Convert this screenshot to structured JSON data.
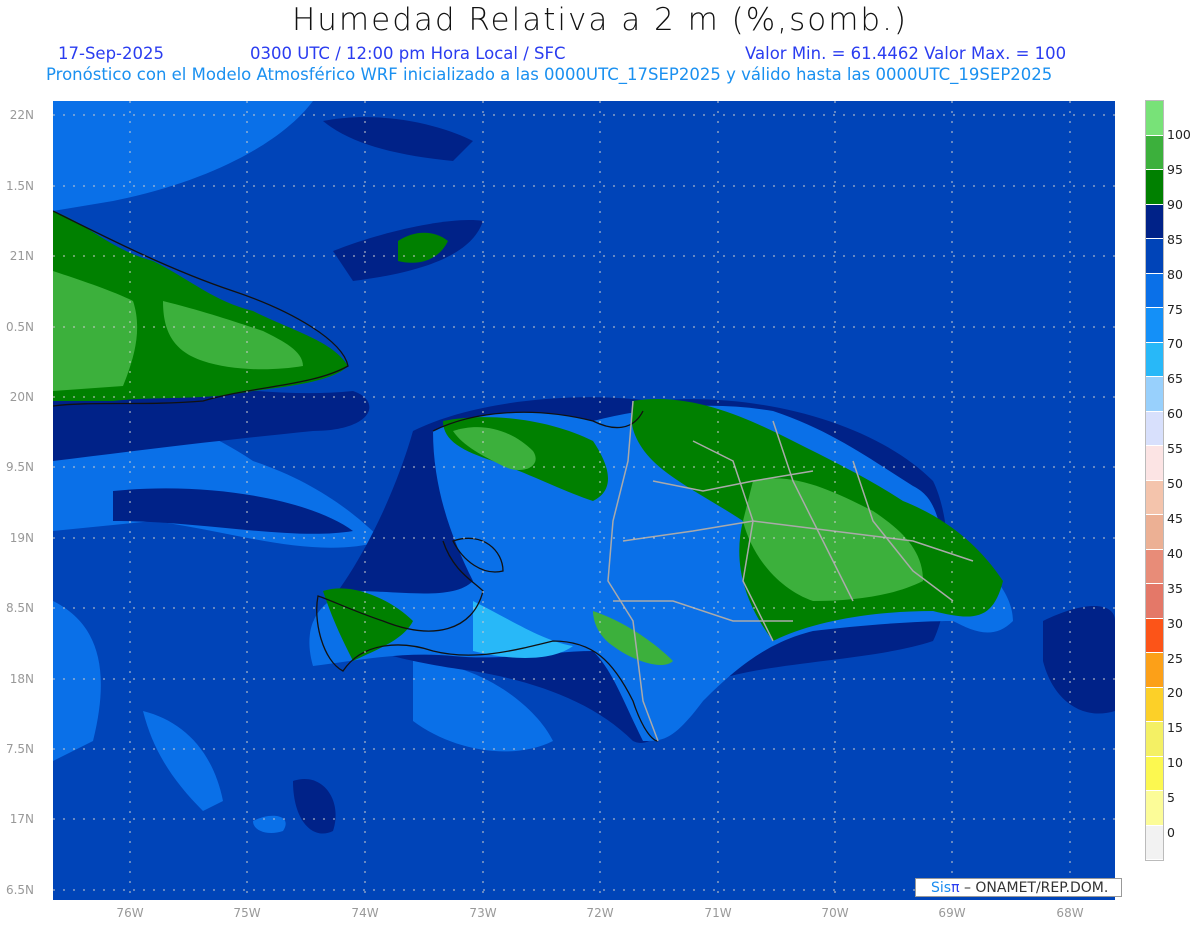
{
  "header": {
    "title": "Humedad Relativa a 2 m (%,somb.)",
    "date": "17-Sep-2025",
    "time": "0300 UTC / 12:00 pm Hora Local / SFC",
    "minmax": "Valor Min. = 61.4462  Valor Max. = 100",
    "model_info": "Pronóstico con el Modelo Atmosférico WRF inicializado a las 0000UTC_17SEP2025 y válido hasta las  0000UTC_19SEP2025"
  },
  "axes": {
    "lat_labels": [
      "22N",
      "1.5N",
      "21N",
      "0.5N",
      "20N",
      "9.5N",
      "19N",
      "8.5N",
      "18N",
      "7.5N",
      "17N",
      "6.5N"
    ],
    "lon_labels": [
      "76W",
      "75W",
      "74W",
      "73W",
      "72W",
      "71W",
      "70W",
      "69W",
      "68W"
    ]
  },
  "colorbar": {
    "labels": [
      "100",
      "95",
      "90",
      "85",
      "80",
      "75",
      "70",
      "65",
      "60",
      "55",
      "50",
      "45",
      "40",
      "35",
      "30",
      "25",
      "20",
      "15",
      "10",
      "5",
      "0"
    ],
    "colors": [
      "#78e278",
      "#3cb03c",
      "#008000",
      "#002288",
      "#0044b8",
      "#0a70e8",
      "#1490f8",
      "#28b8f8",
      "#98d0fc",
      "#d8e0fc",
      "#fce4e4",
      "#f4c4ac",
      "#ecb094",
      "#e88c78",
      "#e47868",
      "#fc5418",
      "#fca018",
      "#fcd028",
      "#f4f064",
      "#fcf850",
      "#fcfc98",
      "#f2f2f2"
    ]
  },
  "credit": {
    "sis": "Sis",
    "pi": "π",
    "text": " –  ONAMET/REP.DOM."
  }
}
